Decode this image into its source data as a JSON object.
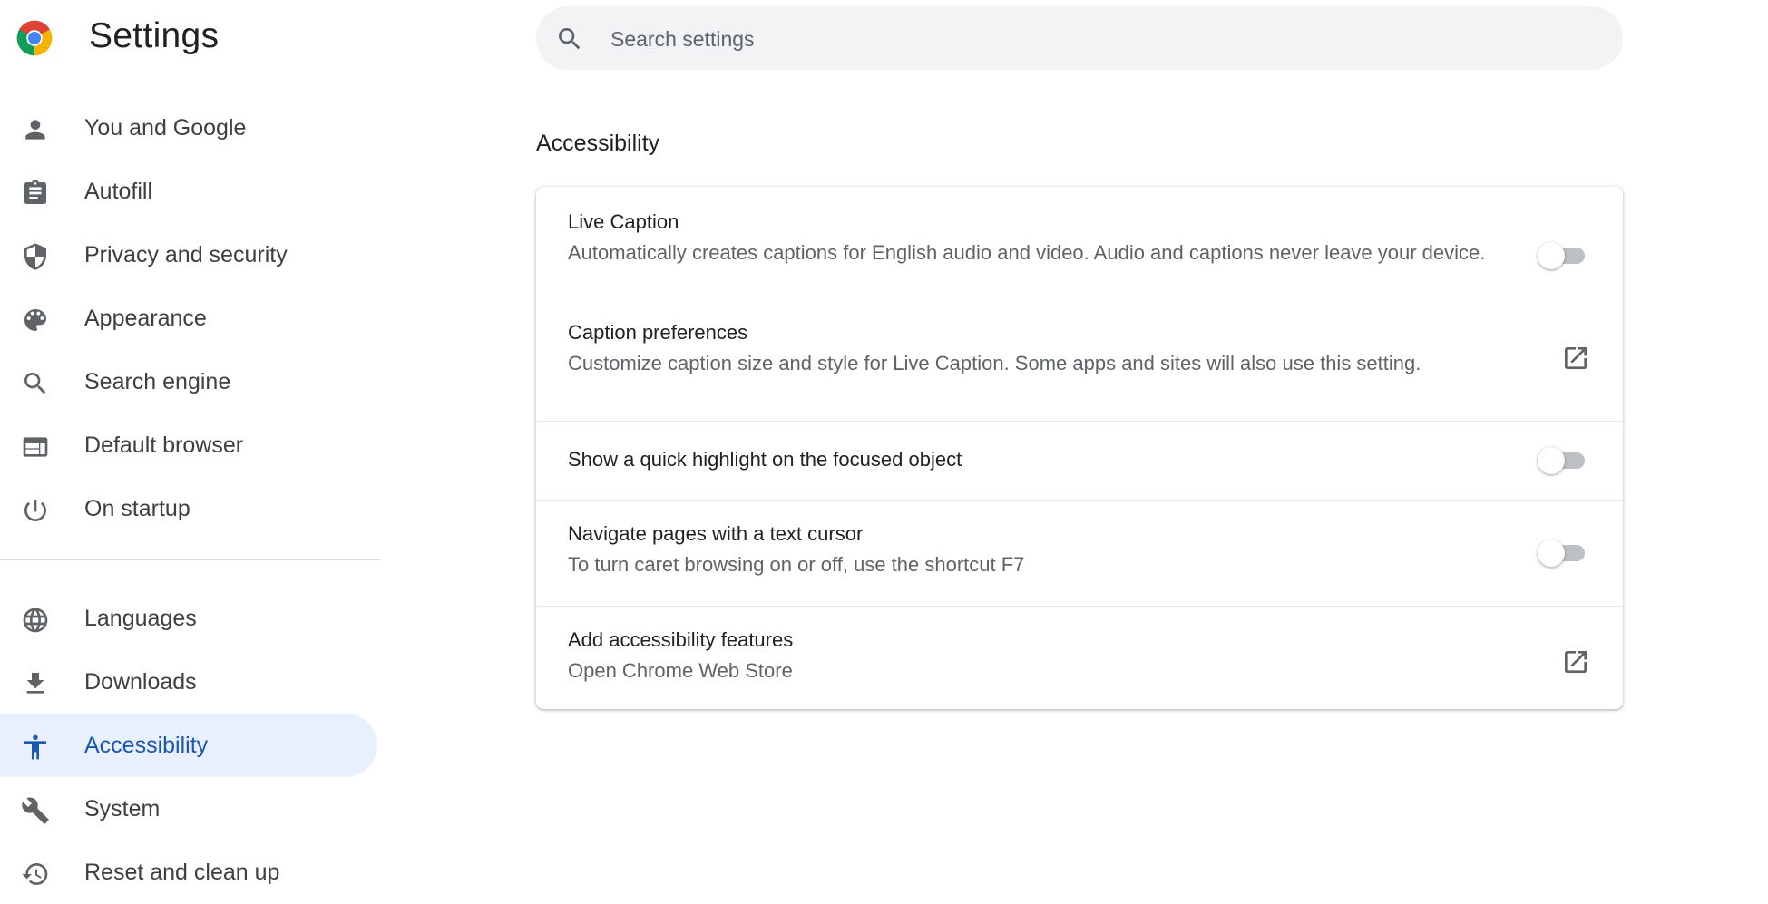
{
  "header": {
    "title": "Settings",
    "logo_icon": "chrome-logo-icon"
  },
  "search": {
    "placeholder": "Search settings"
  },
  "sidebar": {
    "items": [
      {
        "label": "You and Google",
        "icon": "person-icon"
      },
      {
        "label": "Autofill",
        "icon": "clipboard-icon"
      },
      {
        "label": "Privacy and security",
        "icon": "shield-icon"
      },
      {
        "label": "Appearance",
        "icon": "palette-icon"
      },
      {
        "label": "Search engine",
        "icon": "search-icon"
      },
      {
        "label": "Default browser",
        "icon": "browser-window-icon"
      },
      {
        "label": "On startup",
        "icon": "power-icon"
      }
    ],
    "items2": [
      {
        "label": "Languages",
        "icon": "globe-icon"
      },
      {
        "label": "Downloads",
        "icon": "download-icon"
      },
      {
        "label": "Accessibility",
        "icon": "accessibility-icon",
        "active": true
      },
      {
        "label": "System",
        "icon": "wrench-icon"
      },
      {
        "label": "Reset and clean up",
        "icon": "history-icon"
      }
    ]
  },
  "main": {
    "section_title": "Accessibility",
    "rows": [
      {
        "title": "Live Caption",
        "desc": "Automatically creates captions for English audio and video. Audio and captions never leave your device.",
        "control": "toggle",
        "checked": false
      },
      {
        "title": "Caption preferences",
        "desc": "Customize caption size and style for Live Caption. Some apps and sites will also use this setting.",
        "control": "external-link"
      },
      {
        "title": "Show a quick highlight on the focused object",
        "control": "toggle",
        "checked": false
      },
      {
        "title": "Navigate pages with a text cursor",
        "desc": "To turn caret browsing on or off, use the shortcut F7",
        "control": "toggle",
        "checked": false
      },
      {
        "title": "Add accessibility features",
        "desc": "Open Chrome Web Store",
        "control": "external-link"
      }
    ]
  },
  "colors": {
    "accent": "#1a57b4",
    "active_bg": "#e8f0fe",
    "icon_gray": "#5f6368",
    "toggle_off": "#bdc1c6"
  }
}
